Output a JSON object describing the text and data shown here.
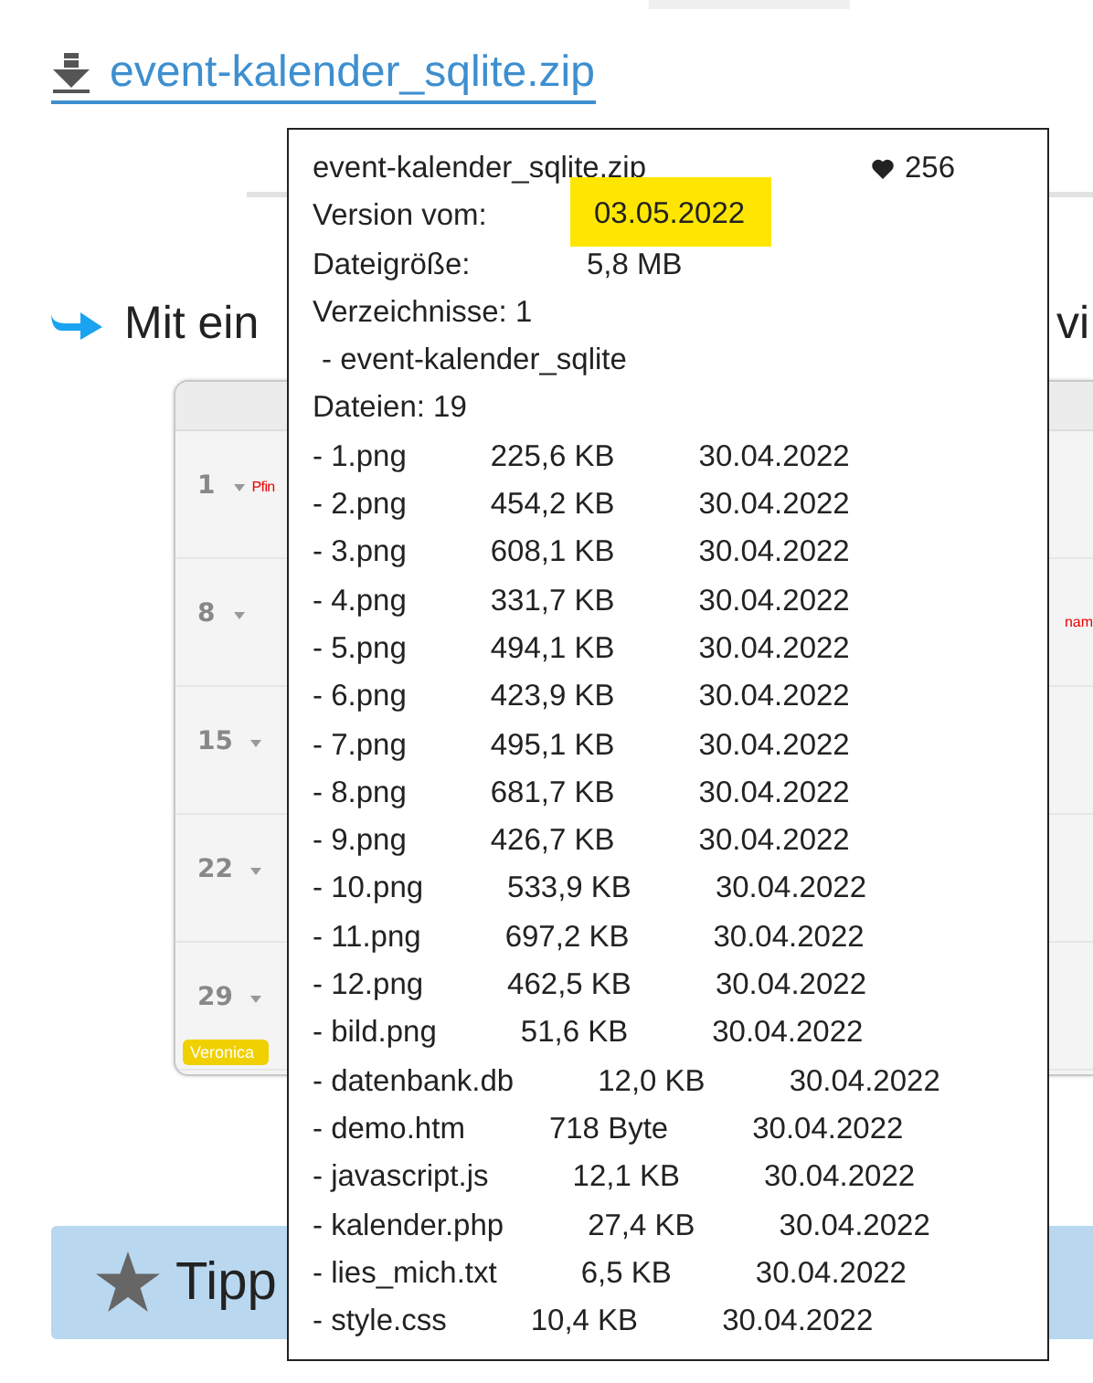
{
  "download_link": {
    "label": "event-kalender_sqlite.zip"
  },
  "intro": {
    "text_start": "Mit ein",
    "text_end": "vi"
  },
  "screenshot": {
    "rows": [
      {
        "day": "1",
        "events": [
          {
            "kind": "label",
            "text": "Pfin"
          }
        ]
      },
      {
        "day": "8",
        "events": [
          {
            "kind": "marginlabel",
            "text": "nam"
          }
        ]
      },
      {
        "day": "15",
        "events": []
      },
      {
        "day": "22",
        "events": []
      },
      {
        "day": "29",
        "events": [
          {
            "kind": "tag",
            "text": "Veronica"
          }
        ]
      }
    ]
  },
  "tooltip": {
    "filename": "event-kalender_sqlite.zip",
    "likes": "256",
    "version_label": "Version vom:",
    "version_date": "03.05.2022",
    "size_label": "Dateigröße:",
    "size": "5,8 MB",
    "folders_label": "Verzeichnisse: 1",
    "folders": [
      "- event-kalender_sqlite"
    ],
    "files_label": "Dateien: 19",
    "files": [
      {
        "name": "- 1.png",
        "size": "225,6 KB",
        "date": "30.04.2022"
      },
      {
        "name": "- 2.png",
        "size": "454,2 KB",
        "date": "30.04.2022"
      },
      {
        "name": "- 3.png",
        "size": "608,1 KB",
        "date": "30.04.2022"
      },
      {
        "name": "- 4.png",
        "size": "331,7 KB",
        "date": "30.04.2022"
      },
      {
        "name": "- 5.png",
        "size": "494,1 KB",
        "date": "30.04.2022"
      },
      {
        "name": "- 6.png",
        "size": "423,9 KB",
        "date": "30.04.2022"
      },
      {
        "name": "- 7.png",
        "size": "495,1 KB",
        "date": "30.04.2022"
      },
      {
        "name": "- 8.png",
        "size": "681,7 KB",
        "date": "30.04.2022"
      },
      {
        "name": "- 9.png",
        "size": "426,7 KB",
        "date": "30.04.2022"
      },
      {
        "name": "- 10.png",
        "size": "533,9 KB",
        "date": "30.04.2022"
      },
      {
        "name": "- 11.png",
        "size": "697,2 KB",
        "date": "30.04.2022"
      },
      {
        "name": "- 12.png",
        "size": "462,5 KB",
        "date": "30.04.2022"
      },
      {
        "name": "- bild.png",
        "size": "51,6 KB",
        "date": "30.04.2022"
      },
      {
        "name": "- datenbank.db",
        "size": "12,0 KB",
        "date": "30.04.2022"
      },
      {
        "name": "- demo.htm",
        "size": "718 Byte",
        "date": "30.04.2022"
      },
      {
        "name": "- javascript.js",
        "size": "12,1 KB",
        "date": "30.04.2022"
      },
      {
        "name": "- kalender.php",
        "size": "27,4 KB",
        "date": "30.04.2022"
      },
      {
        "name": "- lies_mich.txt",
        "size": "6,5 KB",
        "date": "30.04.2022"
      },
      {
        "name": "- style.css",
        "size": "10,4 KB",
        "date": "30.04.2022"
      }
    ]
  },
  "tip": {
    "label": "Tipp"
  }
}
